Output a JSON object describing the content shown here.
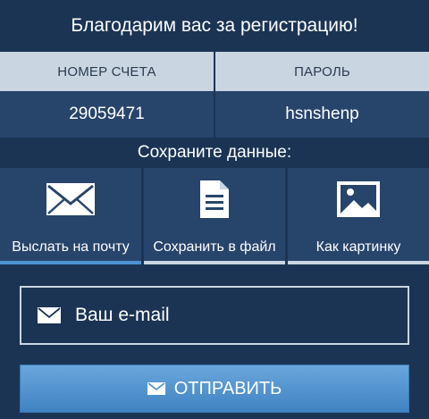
{
  "title": "Благодарим вас за регистрацию!",
  "credentials": {
    "account_header": "НОМЕР СЧЕТА",
    "password_header": "ПАРОЛЬ",
    "account_value": "29059471",
    "password_value": "hsnshenp"
  },
  "save_heading": "Сохраните данные:",
  "options": [
    {
      "label": "Выслать на почту",
      "icon": "envelope-icon",
      "active": true
    },
    {
      "label": "Сохранить в файл",
      "icon": "document-icon",
      "active": false
    },
    {
      "label": "Как картинку",
      "icon": "image-icon",
      "active": false
    }
  ],
  "email": {
    "placeholder": "Ваш e-mail",
    "value": "",
    "icon": "envelope-icon"
  },
  "send_button": {
    "label": "ОТПРАВИТЬ",
    "icon": "envelope-icon"
  },
  "colors": {
    "background": "#1b3454",
    "panel": "#27456b",
    "header": "#c9d6e2",
    "accent": "#4d93d3"
  }
}
